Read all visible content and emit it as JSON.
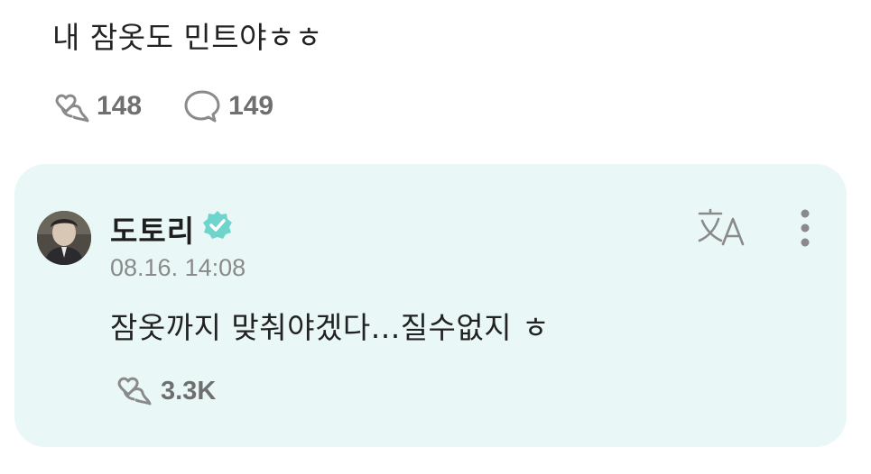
{
  "post": {
    "text": "내 잠옷도 민트야ㅎㅎ",
    "likes": "148",
    "comments": "149"
  },
  "reply": {
    "author": "도토리",
    "verified_icon": "verified-badge-icon",
    "timestamp": "08.16. 14:08",
    "text": "잠옷까지 맞춰야겠다...질수없지 ㅎ",
    "likes": "3.3K"
  },
  "colors": {
    "card_background": "#e9f8f6",
    "verified": "#6fd4cc",
    "icon_gray": "#8a8a8a",
    "count_gray": "#6f6f6f"
  }
}
